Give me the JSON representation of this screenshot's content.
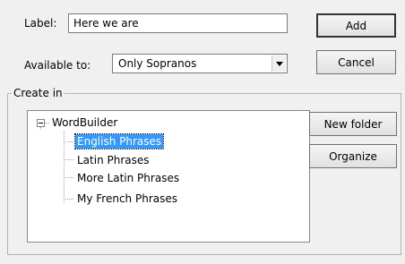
{
  "label_field": {
    "caption": "Label:",
    "value": "Here we are"
  },
  "available_to": {
    "caption": "Available to:",
    "selected": "Only Sopranos"
  },
  "buttons": {
    "add": "Add",
    "cancel": "Cancel",
    "new_folder": "New folder",
    "organize": "Organize"
  },
  "create_in": {
    "legend": "Create in",
    "root": "WordBuilder",
    "expander": "−",
    "items": [
      "English Phrases",
      "Latin Phrases",
      "More Latin Phrases",
      "My French Phrases"
    ],
    "selected_index": 0
  },
  "icons": {
    "dropdown": "chevron-down-icon",
    "collapse": "minus-box-icon"
  }
}
